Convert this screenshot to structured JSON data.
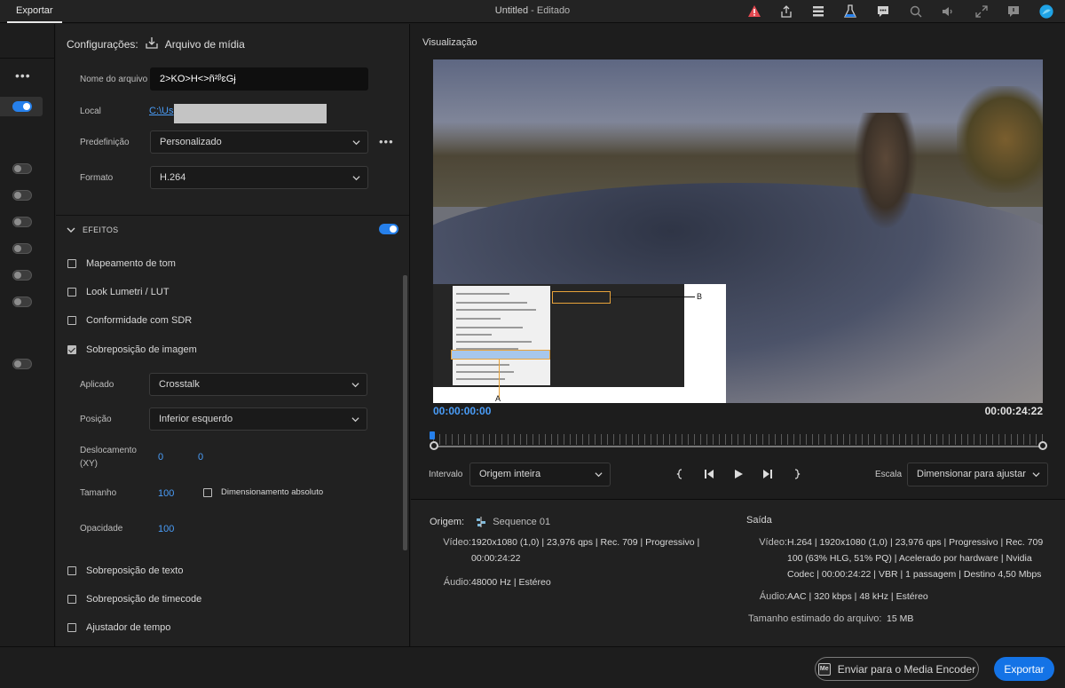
{
  "topbar": {
    "tab_export": "Exportar",
    "title": "Untitled",
    "title_suffix": " - Editado",
    "icons": [
      "warning-icon",
      "share-icon",
      "queue-icon",
      "flask-icon",
      "chat-icon",
      "search-icon",
      "volume-icon",
      "expand-icon",
      "feedback-icon",
      "account-icon"
    ],
    "warning_color": "#e34850",
    "account_color": "#1fa3e6"
  },
  "settings": {
    "header_label": "Configurações:",
    "header_media": "Arquivo de mídia",
    "file_name_label": "Nome do arquivo",
    "file_name_value": "2>KO>H<>ñ²ᵝɛGɉ",
    "location_label": "Local",
    "location_value": "C:\\Us",
    "preset_label": "Predefinição",
    "preset_value": "Personalizado",
    "format_label": "Formato",
    "format_value": "H.264",
    "effects_title": "EFEITOS",
    "effects": [
      {
        "label": "Mapeamento de tom",
        "checked": false
      },
      {
        "label": "Look Lumetri / LUT",
        "checked": false
      },
      {
        "label": "Conformidade com SDR",
        "checked": false
      },
      {
        "label": "Sobreposição de imagem",
        "checked": true
      }
    ],
    "applied_label": "Aplicado",
    "applied_value": "Crosstalk",
    "position_label": "Posição",
    "position_value": "Inferior esquerdo",
    "offset_label": "Deslocamento",
    "offset_label2": "(XY)",
    "offset_x": "0",
    "offset_y": "0",
    "size_label": "Tamanho",
    "size_value": "100",
    "absolute_scaling_label": "Dimensionamento absoluto",
    "opacity_label": "Opacidade",
    "opacity_value": "100",
    "effects_more": [
      {
        "label": "Sobreposição de texto",
        "checked": false
      },
      {
        "label": "Sobreposição de timecode",
        "checked": false
      },
      {
        "label": "Ajustador de tempo",
        "checked": false
      }
    ]
  },
  "preview": {
    "title": "Visualização",
    "timecode_start": "00:00:00:00",
    "timecode_end": "00:00:24:22",
    "overlay_letter_a": "A",
    "overlay_letter_b": "B",
    "range_label": "Intervalo",
    "range_value": "Origem inteira",
    "scale_label": "Escala",
    "scale_value": "Dimensionar para ajustar"
  },
  "info": {
    "source_label": "Origem:",
    "source_name": "Sequence 01",
    "source_video_label": "Vídeo:",
    "source_video_line1": "1920x1080 (1,0)  |  23,976 qps  |  Rec. 709  |  Progressivo  |",
    "source_video_line2": "00:00:24:22",
    "source_audio_label": "Áudio:",
    "source_audio_value": "48000 Hz  |  Estéreo",
    "output_label": "Saída",
    "output_video_label": "Vídeo:",
    "output_video_line1": "H.264  |  1920x1080 (1,0)  |  23,976 qps  |  Progressivo  |  Rec. 709",
    "output_video_line2": "100 (63% HLG, 51% PQ)  |  Acelerado por hardware  |  Nvidia",
    "output_video_line3": "Codec  |  00:00:24:22  |  VBR  |  1 passagem  |  Destino 4,50 Mbps",
    "output_audio_label": "Áudio:",
    "output_audio_value": "AAC  |  320 kbps  |  48 kHz  |  Estéreo",
    "file_size_label": "Tamanho estimado do arquivo:",
    "file_size_value": "15 MB"
  },
  "bottom": {
    "media_encoder_label": "Enviar para o Media Encoder",
    "media_encoder_badge": "Me",
    "export_label": "Exportar",
    "accent": "#1473e6"
  }
}
